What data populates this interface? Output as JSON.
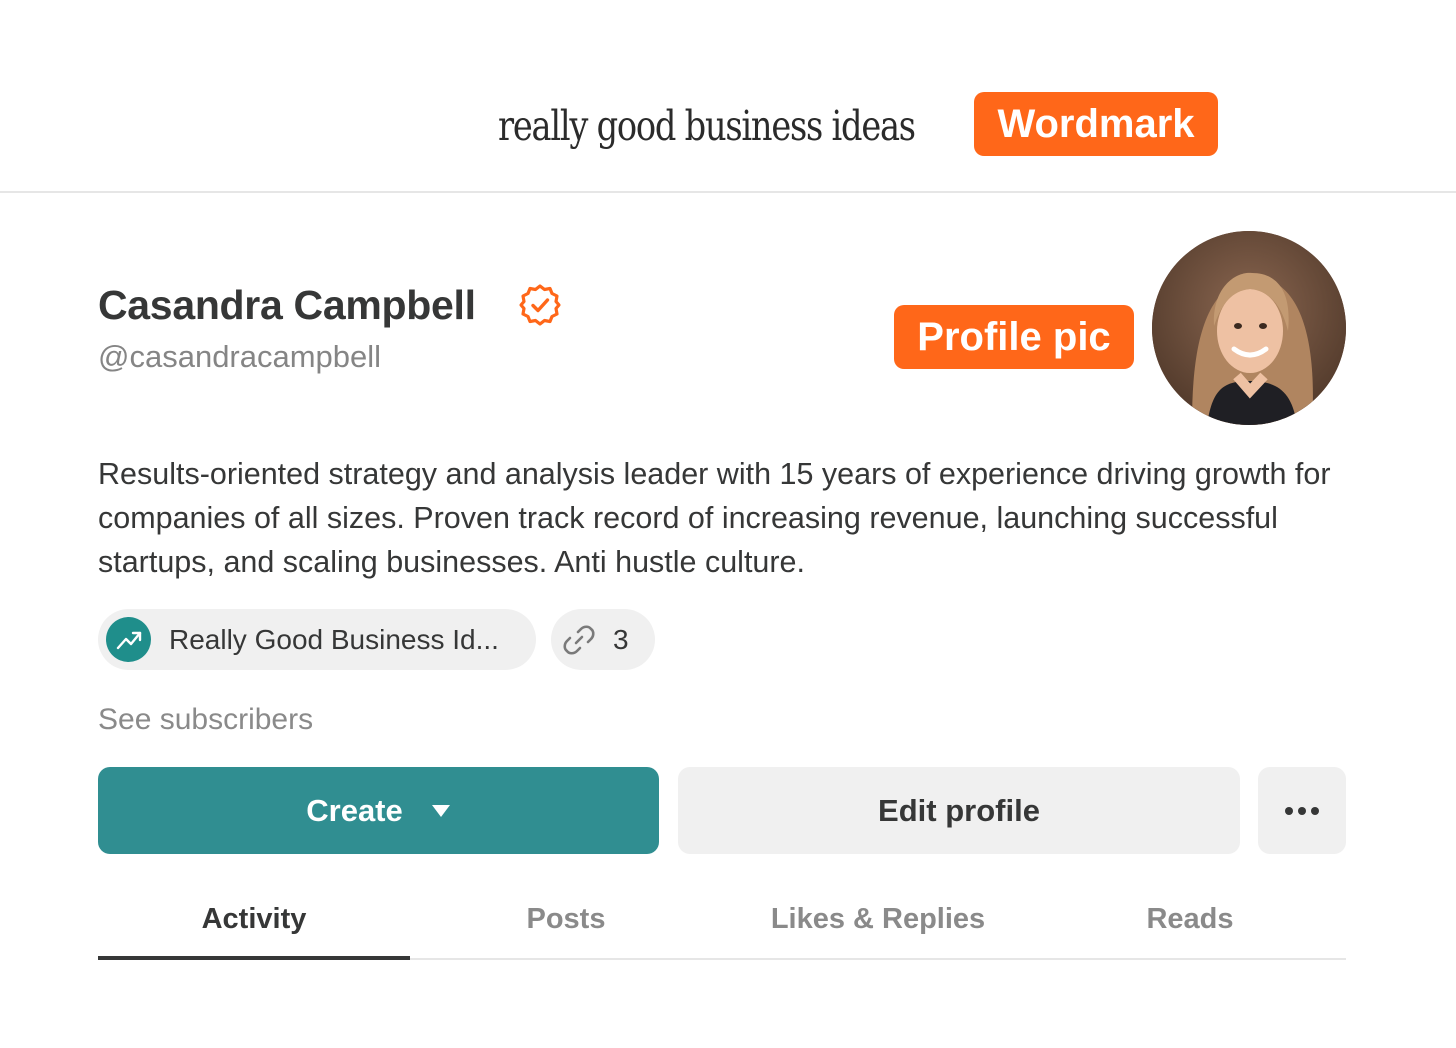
{
  "header": {
    "wordmark": "really good business ideas",
    "wordmark_tag": "Wordmark"
  },
  "profile": {
    "name": "Casandra Campbell",
    "handle": "@casandracampbell",
    "verified_icon": "verified-badge-icon",
    "profile_pic_tag": "Profile pic",
    "bio": "Results-oriented strategy and analysis leader with 15 years of experience driving growth for companies of all sizes. Proven track record of increasing revenue, launching successful startups, and scaling businesses. Anti hustle culture."
  },
  "publication_pill": {
    "label": "Really Good Business Id...",
    "icon": "trending-up-icon"
  },
  "links_pill": {
    "count": "3",
    "icon": "link-icon"
  },
  "see_subscribers": "See subscribers",
  "actions": {
    "create_label": "Create",
    "edit_label": "Edit profile",
    "more_label": "•••"
  },
  "tabs": [
    {
      "label": "Activity",
      "active": true
    },
    {
      "label": "Posts",
      "active": false
    },
    {
      "label": "Likes & Replies",
      "active": false
    },
    {
      "label": "Reads",
      "active": false
    }
  ],
  "colors": {
    "accent_teal": "#308e91",
    "highlight_orange": "#ff6719",
    "text_primary": "#363737",
    "text_muted": "#8a8a8a"
  }
}
